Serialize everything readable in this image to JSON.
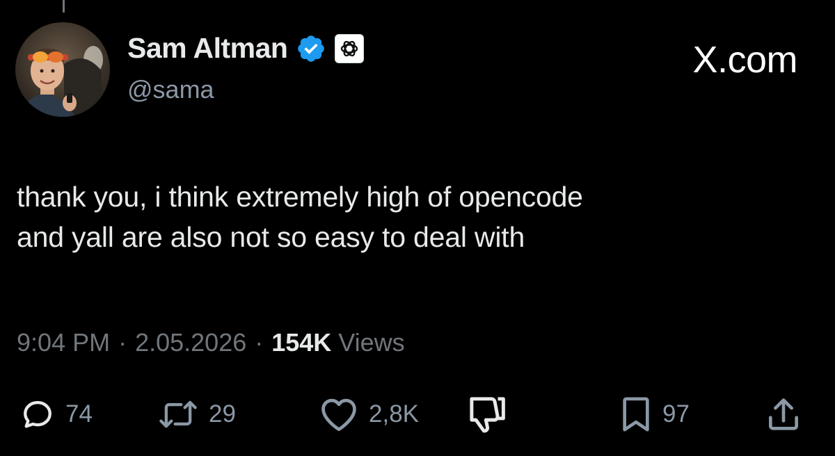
{
  "author": {
    "display_name": "Sam Altman",
    "handle": "@sama",
    "verified": true,
    "verified_color": "#1d9bf0",
    "affiliate_icon": "openai-logo-icon"
  },
  "site_label": "X.com",
  "tweet": {
    "lines": [
      "thank you, i think extremely high of opencode",
      "and yall are also not so easy to deal with"
    ]
  },
  "meta": {
    "time": "9:04 PM",
    "separator": "·",
    "date": "2.05.2026",
    "views_count": "154K",
    "views_label": "Views"
  },
  "actions": {
    "replies": {
      "icon": "reply-icon",
      "count": "74"
    },
    "reposts": {
      "icon": "repost-icon",
      "count": "29"
    },
    "likes": {
      "icon": "heart-icon",
      "count": "2,8K"
    },
    "dislike": {
      "icon": "thumbs-down-icon"
    },
    "bookmarks": {
      "icon": "bookmark-icon",
      "count": "97"
    },
    "share": {
      "icon": "share-icon"
    }
  },
  "colors": {
    "background": "#000000",
    "primary_text": "#e7e9ea",
    "secondary_text": "#71767b",
    "icon": "#8b98a5"
  }
}
